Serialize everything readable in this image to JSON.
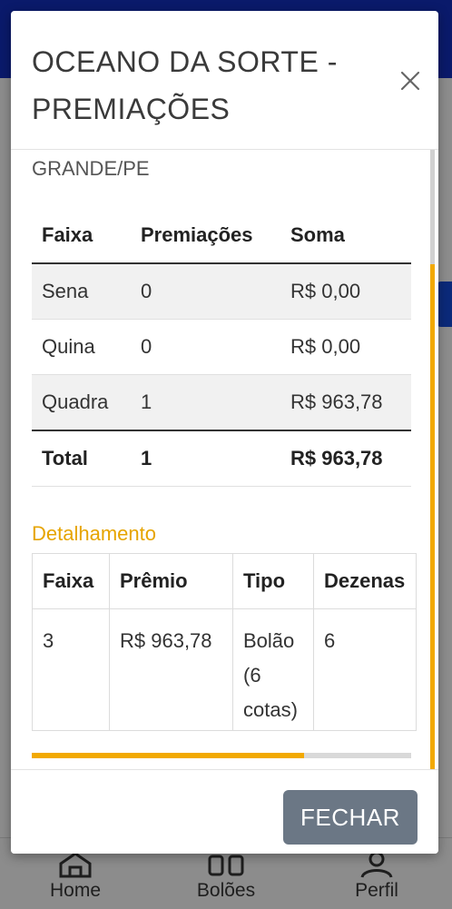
{
  "modal": {
    "title": "OCEANO DA SORTE - PREMIAÇÕES",
    "location": "GRANDE/PE",
    "summary": {
      "headers": [
        "Faixa",
        "Premiações",
        "Soma"
      ],
      "rows": [
        [
          "Sena",
          "0",
          "R$ 0,00"
        ],
        [
          "Quina",
          "0",
          "R$ 0,00"
        ],
        [
          "Quadra",
          "1",
          "R$ 963,78"
        ]
      ],
      "total": [
        "Total",
        "1",
        "R$ 963,78"
      ]
    },
    "detail_title": "Detalhamento",
    "detail": {
      "headers": [
        "Faixa",
        "Prêmio",
        "Tipo",
        "Dezenas"
      ],
      "rows": [
        [
          "3",
          "R$ 963,78",
          "Bolão (6 cotas)",
          "6"
        ]
      ]
    },
    "footer_button": "FECHAR"
  },
  "bottom_nav": [
    {
      "label": "Home",
      "icon": "home-icon"
    },
    {
      "label": "Bolões",
      "icon": "grid-icon"
    },
    {
      "label": "Perfil",
      "icon": "user-icon"
    }
  ],
  "colors": {
    "header_bg": "#0a1a6b",
    "accent": "#f2a900",
    "button_bg": "#6b7785"
  }
}
